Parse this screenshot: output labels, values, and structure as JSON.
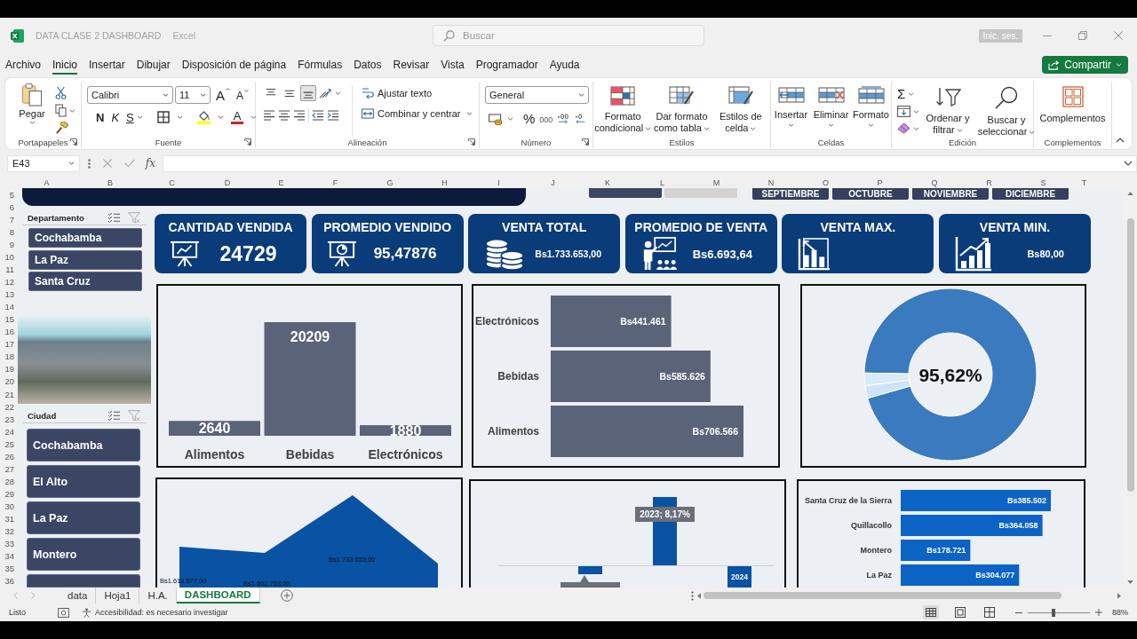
{
  "window": {
    "title": "DATA CLASE 2 DASHBOARD",
    "app": "Excel",
    "search": {
      "placeholder": "Buscar"
    },
    "sign_in": "Inic. ses."
  },
  "menu": {
    "tabs": [
      {
        "label": "Archivo",
        "selected": false
      },
      {
        "label": "Inicio",
        "selected": true
      },
      {
        "label": "Insertar",
        "selected": false
      },
      {
        "label": "Dibujar",
        "selected": false
      },
      {
        "label": "Disposición de página",
        "selected": false
      },
      {
        "label": "Fórmulas",
        "selected": false
      },
      {
        "label": "Datos",
        "selected": false
      },
      {
        "label": "Revisar",
        "selected": false
      },
      {
        "label": "Vista",
        "selected": false
      },
      {
        "label": "Programador",
        "selected": false
      },
      {
        "label": "Ayuda",
        "selected": false
      }
    ],
    "share": "Compartir"
  },
  "ribbon": {
    "clipboard": {
      "paste": "Pegar",
      "label": "Portapapeles"
    },
    "font": {
      "family": "Calibri",
      "size": "11",
      "grow": "A",
      "shrink": "A",
      "bold": "N",
      "italic": "K",
      "underline": "S",
      "font_color": "A",
      "label": "Fuente"
    },
    "alignment": {
      "vertical": [
        {
          "kind": "top",
          "selected": false
        },
        {
          "kind": "middle",
          "selected": false
        },
        {
          "kind": "bottom",
          "selected": true
        }
      ],
      "wrap": "Ajustar texto",
      "merge": "Combinar y centrar",
      "label": "Alineación"
    },
    "number": {
      "format": "General",
      "percent": "%",
      "thousands": "000",
      "label": "Número"
    },
    "styles": {
      "buttons": [
        {
          "label": "Formato condicional",
          "kind": "conditional"
        },
        {
          "label": "Dar formato como tabla",
          "kind": "table"
        },
        {
          "label": "Estilos de celda",
          "kind": "cell-styles"
        }
      ],
      "label": "Estilos"
    },
    "cells": {
      "buttons": [
        {
          "label": "Insertar",
          "kind": "insert"
        },
        {
          "label": "Eliminar",
          "kind": "delete"
        },
        {
          "label": "Formato",
          "kind": "format"
        }
      ],
      "label": "Celdas"
    },
    "editing": {
      "autosum": "Σ",
      "sort": "Ordenar y filtrar",
      "find": "Buscar y seleccionar",
      "label": "Edición"
    },
    "addins": {
      "button": "Complementos",
      "label": "Complementos"
    }
  },
  "formula_bar": {
    "cell": "E43",
    "fx": "fx"
  },
  "columns": [
    "A",
    "B",
    "C",
    "D",
    "E",
    "F",
    "G",
    "H",
    "I",
    "J",
    "K",
    "L",
    "M",
    "N",
    "O",
    "P",
    "Q",
    "R",
    "S",
    "T"
  ],
  "rows": [
    "5",
    "6",
    "7",
    "8",
    "9",
    "10",
    "11",
    "12",
    "13",
    "14",
    "15",
    "16",
    "17",
    "18",
    "19",
    "20",
    "21",
    "22",
    "23",
    "24",
    "25",
    "26",
    "27",
    "28",
    "29",
    "30",
    "31",
    "32",
    "33",
    "34",
    "35",
    "36"
  ],
  "dashboard": {
    "year_buttons": [
      {
        "selected": true
      },
      {
        "selected": false
      }
    ],
    "months": [
      {
        "label": "SEPTIEMBRE",
        "selected": true
      },
      {
        "label": "OCTUBRE",
        "selected": true
      },
      {
        "label": "NOVIEMBRE",
        "selected": true
      },
      {
        "label": "DICIEMBRE",
        "selected": true
      }
    ],
    "slicers": [
      {
        "title": "Departamento",
        "items": [
          {
            "label": "Cochabamba",
            "selected": true
          },
          {
            "label": "La Paz",
            "selected": true
          },
          {
            "label": "Santa Cruz",
            "selected": true
          }
        ]
      },
      {
        "title": "Ciudad",
        "items": [
          {
            "label": "Cochabamba",
            "selected": true
          },
          {
            "label": "El Alto",
            "selected": true
          },
          {
            "label": "La Paz",
            "selected": true
          },
          {
            "label": "Montero",
            "selected": true
          },
          {
            "selected": true
          }
        ]
      }
    ],
    "kpis": [
      {
        "title": "CANTIDAD VENDIDA",
        "value": "24729",
        "kind": "easel-bars"
      },
      {
        "title": "PROMEDIO VENDIDO",
        "value": "95,47876",
        "kind": "easel-pie"
      },
      {
        "title": "VENTA TOTAL",
        "value": "Bs1.733.653,00",
        "kind": "coins"
      },
      {
        "title": "PROMEDIO DE VENTA",
        "value": "Bs6.693,64",
        "kind": "presenter"
      },
      {
        "title": "VENTA MAX.",
        "kind": "bar-chart"
      },
      {
        "title": "VENTA MIN.",
        "value": "Bs80,00",
        "kind": "rising-chart"
      }
    ],
    "category_quantity_chart": {
      "chart_data": {
        "type": "bar",
        "categories": [
          "Alimentos",
          "Bebidas",
          "Electrónicos"
        ],
        "values": [
          2640,
          20209,
          1880
        ],
        "data_labels": true
      }
    },
    "category_sales_chart": {
      "chart_data": {
        "type": "bar",
        "orientation": "horizontal",
        "categories": [
          "Electrónicos",
          "Bebidas",
          "Alimentos"
        ],
        "values": [
          441461,
          585626,
          706566
        ],
        "value_labels": [
          "Bs441.461",
          "Bs585.626",
          "Bs706.566"
        ]
      }
    },
    "donut_chart": {
      "label": "95,62%"
    },
    "area_chart": {
      "labels": [
        "Bs1.618.577,00",
        "Bs1.602.753,00",
        "Bs1.733.653,00"
      ]
    },
    "year_change_chart": {
      "callout": "2023; 8,17%",
      "bar_label": "2024"
    },
    "city_sales_chart": {
      "chart_data": {
        "type": "bar",
        "orientation": "horizontal",
        "categories": [
          "Santa Cruz de la Sierra",
          "Quillacollo",
          "Montero",
          "La Paz"
        ],
        "values": [
          385502,
          364058,
          178721,
          304077
        ],
        "value_labels": [
          "Bs385.502",
          "Bs364.058",
          "Bs178.721",
          "Bs304.077"
        ]
      }
    }
  },
  "sheet_tabs": [
    {
      "label": "data",
      "selected": false
    },
    {
      "label": "Hoja1",
      "selected": false
    },
    {
      "label": "H.A.",
      "selected": false
    },
    {
      "label": "DASHBOARD",
      "selected": true
    }
  ],
  "status_bar": {
    "ready": "Listo",
    "accessibility": "Accesibilidad: es necesario investigar",
    "views": [
      {
        "kind": "normal",
        "selected": true
      },
      {
        "kind": "page-layout",
        "selected": false
      },
      {
        "kind": "page-break",
        "selected": false
      }
    ],
    "zoom": {
      "level": 0.42,
      "label": "88%"
    }
  }
}
